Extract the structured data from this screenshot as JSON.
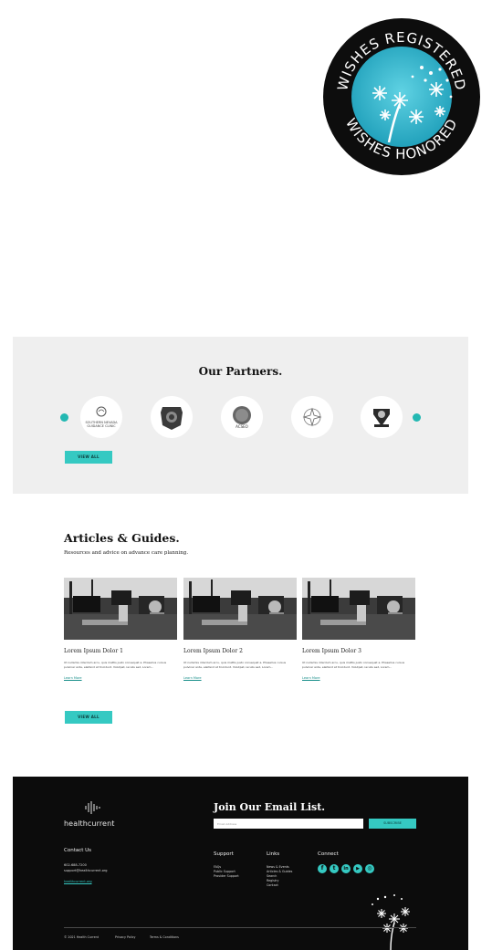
{
  "badge": {
    "top_text": "WISHES REGISTERED",
    "bottom_text": "WISHES HONORED",
    "colors": {
      "ring": "#0d0d0d",
      "center": "#2fb5cc",
      "text": "#ffffff"
    }
  },
  "partners": {
    "title": "Our Partners.",
    "logos": [
      {
        "icon": "guidance-clinic-icon",
        "caption": "SOUTHERN NEVADA GUIDANCE CLINIC"
      },
      {
        "icon": "shield-emblem-icon",
        "caption": ""
      },
      {
        "icon": "round-seal-icon",
        "caption": "ACSEO"
      },
      {
        "icon": "compass-star-icon",
        "caption": ""
      },
      {
        "icon": "crest-icon",
        "caption": ""
      }
    ],
    "button_label": "VIEW ALL"
  },
  "articles": {
    "title": "Articles & Guides.",
    "subtitle": "Resources and advice on advance care planning.",
    "cards": [
      {
        "title": "Lorem Ipsum Dolor 1",
        "body": "Ut nullamis interdum arcu, quis mattis justo consequat a. Phasellus cursus pulvinar ante, eleifend at tincidunt. Volutpat, iaculis sed, Lorem...",
        "link": "Learn More"
      },
      {
        "title": "Lorem Ipsum Dolor 2",
        "body": "Ut nullamis interdum arcu, quis mattis justo consequat a. Phasellus cursus pulvinar ante, eleifend at tincidunt. Volutpat, iaculis sed, Lorem...",
        "link": "Learn More"
      },
      {
        "title": "Lorem Ipsum Dolor 3",
        "body": "Ut nullamis interdum arcu, quis mattis justo consequat a. Phasellus cursus pulvinar ante, eleifend at tincidunt. Volutpat, iaculis sed, Lorem...",
        "link": "Learn More"
      }
    ],
    "button_label": "VIEW ALL"
  },
  "footer": {
    "brand": "healthcurrent",
    "join_title": "Join Our Email List.",
    "email_placeholder": "Email Address",
    "subscribe_label": "SUBSCRIBE",
    "contact": {
      "heading": "Contact Us",
      "phone": "602-688-7200",
      "email": "support@healthcurrent.org",
      "link": "healthcurrent.org"
    },
    "support": {
      "heading": "Support",
      "items": [
        "FAQs",
        "Public Support",
        "Provider Support"
      ]
    },
    "links": {
      "heading": "Links",
      "items": [
        "News & Events",
        "Articles & Guides",
        "Search",
        "Registry",
        "Contact"
      ]
    },
    "connect": {
      "heading": "Connect",
      "icons": [
        {
          "icon": "facebook-icon",
          "glyph": "f"
        },
        {
          "icon": "twitter-icon",
          "glyph": "t"
        },
        {
          "icon": "linkedin-icon",
          "glyph": "in"
        },
        {
          "icon": "youtube-icon",
          "glyph": "▶"
        },
        {
          "icon": "instagram-icon",
          "glyph": "◎"
        }
      ]
    },
    "legal": {
      "copyright": "© 2021 Health Current",
      "privacy": "Privacy Policy",
      "terms": "Terms & Conditions"
    }
  },
  "colors": {
    "accent": "#35c9c2",
    "footer_bg": "#0c0c0c",
    "partners_bg": "#efefef"
  }
}
